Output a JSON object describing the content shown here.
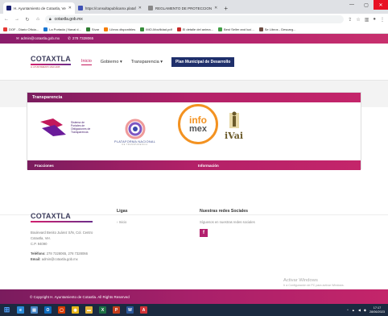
{
  "browser": {
    "tabs": [
      {
        "title": "H. Ayuntamiento de Cotaxtla, Ve",
        "active": true,
        "color": "#1a1f71"
      },
      {
        "title": "https://consultapublicamx.plataf",
        "active": false,
        "color": "#3f51b5"
      },
      {
        "title": "REGLAMENTO DE PROTECCION",
        "active": false,
        "color": "#888888"
      }
    ],
    "new_tab": "+",
    "url": "cotaxtla.gob.mx",
    "bookmarks": [
      "DOF - Diario Oficia...",
      "La Portada | Naval d...",
      "Sívar",
      "Libros disponibles",
      "IMO-Movilidad.pdf",
      "El detalle del anima...",
      "Best Seller and lucí...",
      "Se Libros - Descarg..."
    ]
  },
  "site": {
    "top_strip": {
      "email": "admin@cotaxtla.gob.mx",
      "phone": "278 7328065"
    },
    "logo": {
      "name": "COTAXTLA",
      "tagline": "H. AYUNTAMIENTO 2022-2025"
    },
    "nav": {
      "inicio": "Inicio",
      "gobierno": "Gobierno",
      "transparencia": "Transparencia",
      "plan": "Plan Municipal de Desarrollo"
    },
    "transparencia": {
      "title": "Transparencia",
      "sipot_text": "Sistema de Portales de Obligaciones de Transparencia",
      "pnt_name": "PLATAFORMA NACIONAL",
      "pnt_sub": "DE TRANSPARENCIA",
      "infomex_top": "info",
      "infomex_bottom": "mex",
      "ivai": "iVai",
      "col_fracciones": "Fracciones",
      "col_informacion": "Información"
    },
    "footer": {
      "logo": "COTAXTLA",
      "address_1": "Boulevard Benito Juárez S/N, Col. Centro",
      "address_2": "Cotaxtla, Ver.",
      "address_3": "C.P. 94090",
      "phone_label": "Teléfono:",
      "phone_value": "278 7328065, 278 7328066",
      "email_label": "Email:",
      "email_value": "admin@cotaxtla.gob.mx",
      "links_title": "Ligas",
      "links_item": "Inicio",
      "social_title": "Nuestras redes Sociales",
      "social_text": "Síguenos en nuestras redes sociales",
      "facebook_glyph": "f",
      "copyright": "© Copyright H. Ayuntamiento de Cotaxtla. All Rights Reserved"
    },
    "watermark": {
      "line1": "Activar Windows",
      "line2": "Ir a Configuración de PC para activar Windows."
    }
  },
  "taskbar": {
    "apps": [
      {
        "name": "windows-icon",
        "glyph": "⊞",
        "color": "#1b2a40"
      },
      {
        "name": "edge-icon",
        "glyph": "e",
        "color": "#2b8ad8"
      },
      {
        "name": "file-manager-icon",
        "glyph": "▤",
        "color": "#4a88c7"
      },
      {
        "name": "outlook-icon",
        "glyph": "O",
        "color": "#0f6cbd"
      },
      {
        "name": "office-icon",
        "glyph": "▢",
        "color": "#d83b01"
      },
      {
        "name": "chrome-icon",
        "glyph": "◉",
        "color": "#e8b71a"
      },
      {
        "name": "folder-icon",
        "glyph": "▬",
        "color": "#e7b53a"
      },
      {
        "name": "excel-icon",
        "glyph": "X",
        "color": "#1e7145"
      },
      {
        "name": "powerpoint-icon",
        "glyph": "P",
        "color": "#c43e1c"
      },
      {
        "name": "word-icon",
        "glyph": "W",
        "color": "#2b579a"
      },
      {
        "name": "pdf-icon",
        "glyph": "A",
        "color": "#d13438"
      }
    ],
    "time": "17:17",
    "date": "28/06/2023"
  },
  "colors": {
    "brand_magenta": "#b32168",
    "nav_dark_blue": "#1f2f6b",
    "infomex_orange": "#f39221"
  }
}
